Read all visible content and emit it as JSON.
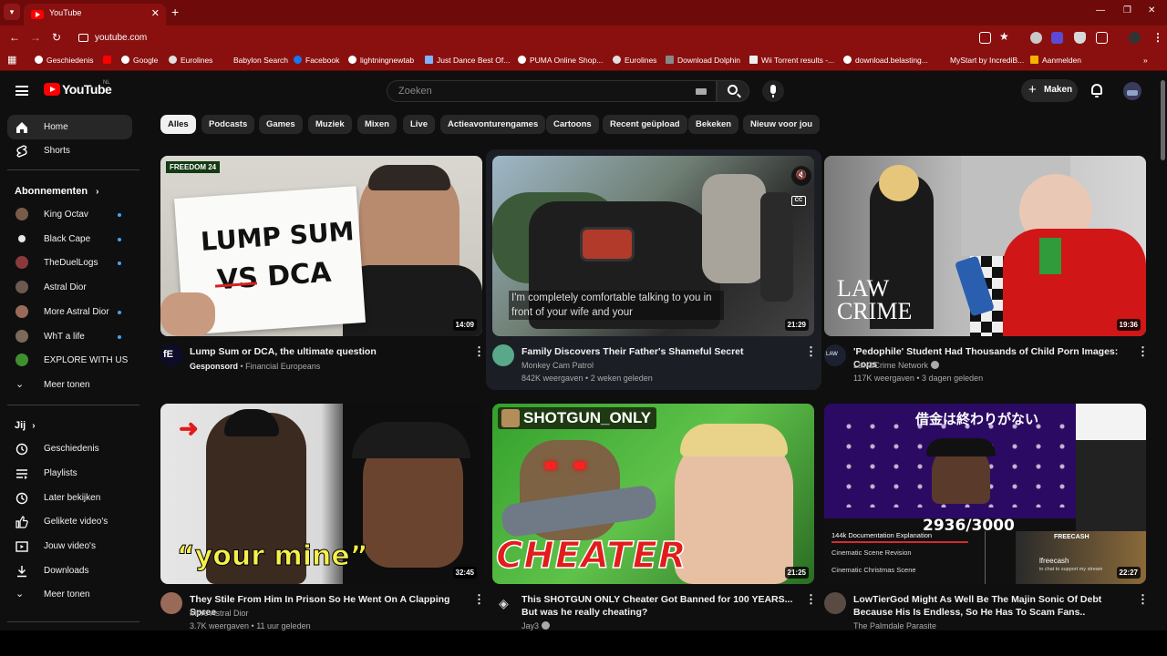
{
  "browser": {
    "tab_title": "YouTube",
    "url": "youtube.com",
    "bookmarks": [
      "Geschiedenis",
      "Google",
      "Eurolines",
      "Babylon Search",
      "Facebook",
      "lightningnewtab",
      "Just Dance Best Of...",
      "PUMA Online Shop...",
      "Eurolines",
      "Download Dolphin",
      "Wii Torrent results -...",
      "download.belasting...",
      "MyStart by IncrediB...",
      "Aanmelden"
    ]
  },
  "header": {
    "logo_text": "YouTube",
    "region": "NL",
    "search_placeholder": "Zoeken",
    "create_label": "Maken"
  },
  "sidebar": {
    "main": [
      {
        "label": "Home"
      },
      {
        "label": "Shorts"
      }
    ],
    "subscriptions_title": "Abonnementen",
    "subscriptions": [
      {
        "label": "King Octav",
        "color": "#7a5a48"
      },
      {
        "label": "Black Cape",
        "color": "#e8e8e8"
      },
      {
        "label": "TheDuelLogs",
        "color": "#8a3a3a"
      },
      {
        "label": "Astral Dior",
        "color": "#6b5a50"
      },
      {
        "label": "More Astral Dior",
        "color": "#9a6a58"
      },
      {
        "label": "WhT a life",
        "color": "#7a6a5a"
      },
      {
        "label": "EXPLORE WITH US",
        "color": "#3f8f2f"
      },
      {
        "label": "Meer tonen"
      }
    ],
    "you_title": "Jij",
    "you_items": [
      {
        "label": "Geschiedenis"
      },
      {
        "label": "Playlists"
      },
      {
        "label": "Later bekijken"
      },
      {
        "label": "Gelikete video's"
      },
      {
        "label": "Jouw video's"
      },
      {
        "label": "Downloads"
      },
      {
        "label": "Meer tonen"
      }
    ]
  },
  "chips": [
    "Alles",
    "Podcasts",
    "Games",
    "Muziek",
    "Mixen",
    "Live",
    "Actieavonturengames",
    "Cartoons",
    "Recent geüpload",
    "Bekeken",
    "Nieuw voor jou"
  ],
  "videos": [
    {
      "title": "Lump Sum or DCA, the ultimate question",
      "sponsored": "Gesponsord",
      "channel": "Financial Europeans",
      "duration": "14:09",
      "thumb_brand": "FREEDOM 24",
      "thumb_text_1": "LUMP SUM",
      "thumb_text_2": "VS DCA"
    },
    {
      "title": "Family Discovers Their Father's Shameful Secret",
      "channel": "Monkey Cam Patrol",
      "meta": "842K weergaven • 2 weken geleden",
      "duration": "21:29",
      "caption": "I'm completely comfortable talking to you in front of your wife and your",
      "cc": "CC"
    },
    {
      "title": "'Pedophile' Student Had Thousands of Child Porn Images: Cops",
      "channel": "Law&Crime Network",
      "meta": "117K weergaven • 3 dagen geleden",
      "duration": "19:36",
      "thumb_text_1": "LAW",
      "thumb_text_2": "CRIME"
    },
    {
      "title": "They Stile From Him In Prison So He Went On A Clapping Spree",
      "channel": "More Astral Dior",
      "meta": "3.7K weergaven • 11 uur geleden",
      "duration": "32:45",
      "thumb_text_1": "“your mine”"
    },
    {
      "title": "This SHOTGUN ONLY Cheater Got Banned for 100 YEARS... But was he really cheating?",
      "channel": "Jay3",
      "duration": "21:25",
      "thumb_text_1": "SHOTGUN_ONLY",
      "thumb_text_2": "CHEATER"
    },
    {
      "title": "LowTierGod Might As Well Be The Majin Sonic Of Debt Because His Is Endless, So He Has To Scam Fans..",
      "channel": "The Palmdale Parasite",
      "duration": "22:27",
      "thumb_text_1": "借金は終わりがない",
      "thumb_text_2": "2936/3000",
      "thumb_text_3": "144k Documentation Explanation",
      "thumb_text_4": "Cinematic Scene Revision",
      "thumb_text_5": "Cinematic Christmas Scene",
      "thumb_text_6": "FREECASH",
      "thumb_text_7": "lfreecash",
      "thumb_text_8": "in chat to support my stream"
    }
  ]
}
